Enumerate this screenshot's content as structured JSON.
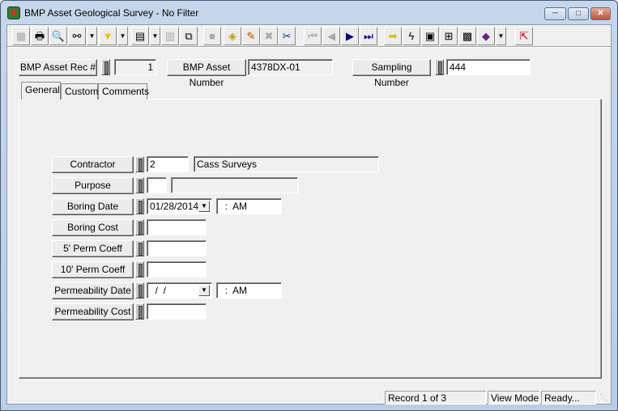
{
  "window": {
    "title": "BMP Asset Geological Survey - No Filter",
    "controls": [
      "minimize",
      "maximize",
      "close"
    ]
  },
  "toolbar": {
    "buttons": [
      {
        "icon": "form-view-icon",
        "enabled": false
      },
      {
        "icon": "printer-icon",
        "enabled": true
      },
      {
        "icon": "print-preview-icon",
        "enabled": true
      },
      {
        "icon": "binoculars-find-icon",
        "enabled": true,
        "dropdown": true
      },
      {
        "icon": "filter-funnel-icon",
        "enabled": true,
        "dropdown": true
      },
      {
        "icon": "report-icon",
        "enabled": true,
        "dropdown": true
      },
      {
        "icon": "properties-icon",
        "enabled": false
      },
      {
        "icon": "export-icon",
        "enabled": true
      },
      {
        "icon": "save-icon",
        "enabled": false
      },
      {
        "icon": "new-record-icon",
        "enabled": true
      },
      {
        "icon": "pencil-edit-icon",
        "enabled": true
      },
      {
        "icon": "delete-x-icon",
        "enabled": false
      },
      {
        "icon": "scissors-cut-icon",
        "enabled": true
      },
      {
        "icon": "first-record-icon",
        "enabled": false
      },
      {
        "icon": "previous-record-icon",
        "enabled": false
      },
      {
        "icon": "next-record-icon",
        "enabled": true
      },
      {
        "icon": "last-record-icon",
        "enabled": true
      },
      {
        "icon": "goto-arrow-icon",
        "enabled": true
      },
      {
        "icon": "lightning-icon",
        "enabled": true
      },
      {
        "icon": "diagram-icon",
        "enabled": true
      },
      {
        "icon": "hierarchy-icon",
        "enabled": true
      },
      {
        "icon": "map-icon",
        "enabled": true
      },
      {
        "icon": "book-icon",
        "enabled": true,
        "dropdown": true
      },
      {
        "icon": "exit-icon",
        "enabled": true
      }
    ]
  },
  "header": {
    "rec_label": "BMP Asset Rec #",
    "rec_value": "1",
    "number_label": "BMP Asset Number",
    "number_value": "4378DX-01",
    "sampling_label": "Sampling Number",
    "sampling_value": "444"
  },
  "tabs": [
    {
      "label": "General",
      "active": true
    },
    {
      "label": "Custom"
    },
    {
      "label": "Comments"
    }
  ],
  "form": {
    "contractor": {
      "label": "Contractor",
      "code": "2",
      "name": "Cass Surveys"
    },
    "purpose": {
      "label": "Purpose",
      "code": "",
      "name": ""
    },
    "boring_date": {
      "label": "Boring Date",
      "date": "01/28/2014",
      "time": "  :  AM"
    },
    "boring_cost": {
      "label": "Boring Cost",
      "value": ""
    },
    "perm5": {
      "label": "5' Perm Coeff",
      "value": ""
    },
    "perm10": {
      "label": "10' Perm Coeff",
      "value": ""
    },
    "perm_date": {
      "label": "Permeability Date",
      "date": "  /  /",
      "time": "  :  AM"
    },
    "perm_cost": {
      "label": "Permeability Cost",
      "value": ""
    }
  },
  "status": {
    "record": "Record 1 of 3",
    "mode": "View Mode",
    "state": "Ready..."
  }
}
